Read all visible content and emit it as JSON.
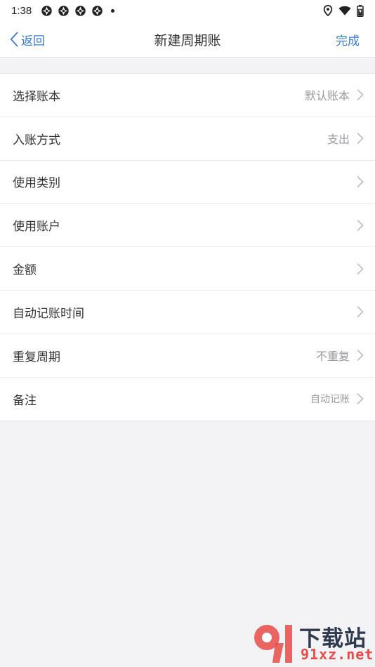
{
  "status_bar": {
    "time": "1:38",
    "notification_icons": [
      "app-notification-icon",
      "app-notification-icon",
      "app-notification-icon",
      "app-notification-icon"
    ],
    "right_icons": [
      "location-icon",
      "wifi-icon",
      "battery-icon"
    ]
  },
  "nav": {
    "back_label": "返回",
    "title": "新建周期账",
    "done_label": "完成"
  },
  "rows": [
    {
      "label": "选择账本",
      "value": "默认账本"
    },
    {
      "label": "入账方式",
      "value": "支出"
    },
    {
      "label": "使用类别",
      "value": ""
    },
    {
      "label": "使用账户",
      "value": ""
    },
    {
      "label": "金额",
      "value": ""
    },
    {
      "label": "自动记账时间",
      "value": ""
    },
    {
      "label": "重复周期",
      "value": "不重复"
    },
    {
      "label": "备注",
      "value": "自动记账"
    }
  ],
  "watermark": {
    "title": "下载站",
    "url": "91xz.net"
  },
  "colors": {
    "accent": "#3a7bd5",
    "background": "#f3f3f6",
    "secondary_text": "#9a9a9f",
    "watermark_red": "#e84a48"
  }
}
